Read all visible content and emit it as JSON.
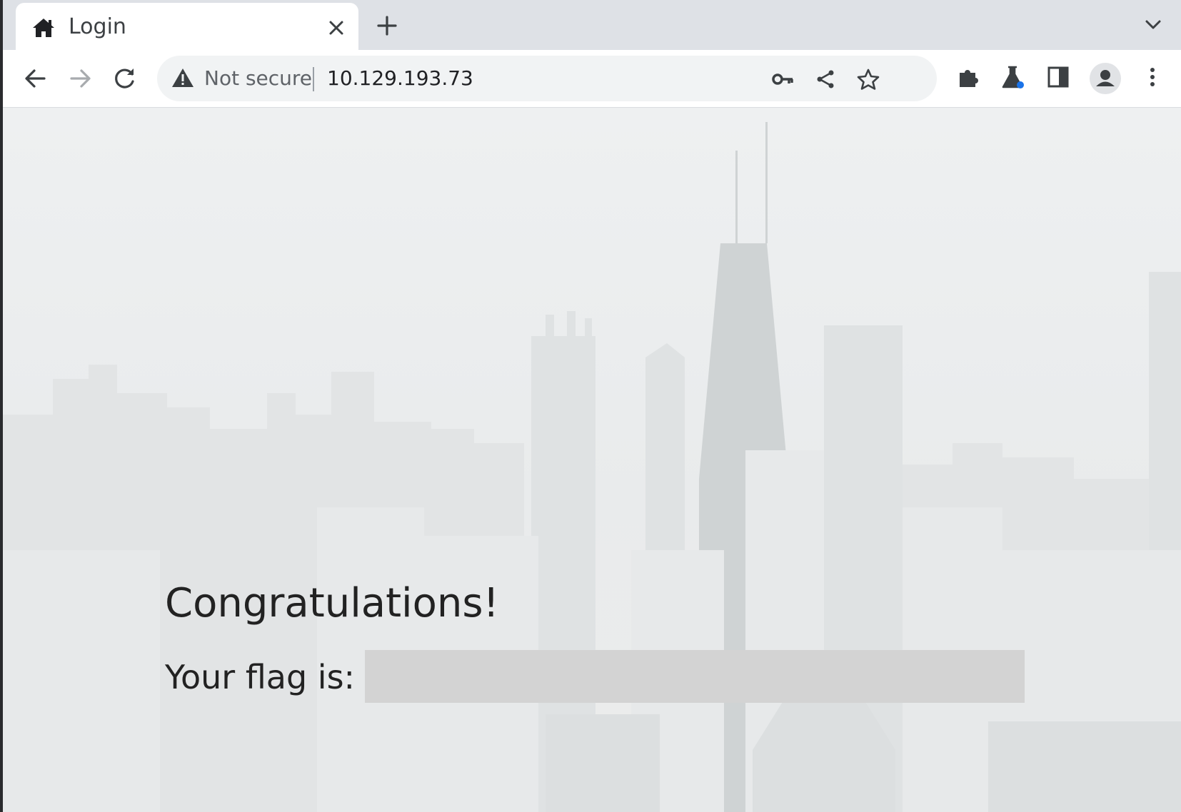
{
  "tab": {
    "title": "Login",
    "icon": "home-icon"
  },
  "toolbar": {
    "security_label": "Not secure",
    "url": "10.129.193.73",
    "icons": [
      "back-arrow-icon",
      "forward-arrow-icon",
      "reload-icon",
      "warning-icon",
      "key-icon",
      "share-icon",
      "star-icon",
      "extensions-puzzle-icon",
      "labs-flask-icon",
      "side-panel-icon",
      "profile-avatar-icon",
      "kebab-menu-icon"
    ]
  },
  "page": {
    "heading": "Congratulations!",
    "flag_label": "Your flag is:",
    "flag_value": ""
  },
  "colors": {
    "tabstrip": "#dee1e6",
    "omnibox": "#f1f3f4",
    "text": "#222222",
    "flag_redaction": "#d3d3d3",
    "accent_blue": "#1a73e8"
  }
}
